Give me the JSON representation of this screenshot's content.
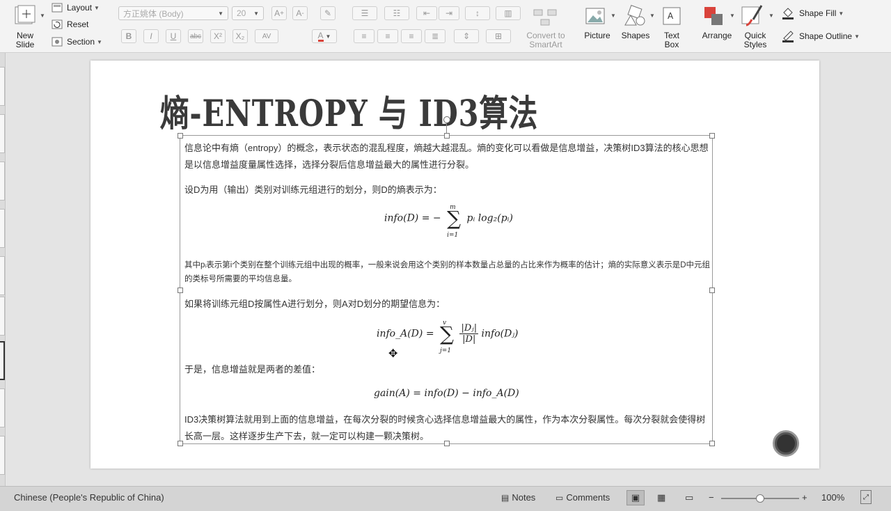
{
  "ribbon": {
    "new_slide": "New\nSlide",
    "layout": "Layout",
    "reset": "Reset",
    "section": "Section",
    "font_name": "方正姚体 (Body)",
    "font_size": "20",
    "convert_smartart": "Convert to\nSmartArt",
    "picture": "Picture",
    "shapes": "Shapes",
    "text_box": "Text\nBox",
    "arrange": "Arrange",
    "quick_styles": "Quick\nStyles",
    "shape_fill": "Shape Fill",
    "shape_outline": "Shape Outline",
    "format_buttons": [
      "B",
      "I",
      "U",
      "abc",
      "X²",
      "X₂",
      "AV",
      "A"
    ],
    "accent": "#d9433b"
  },
  "slide": {
    "title": "熵-ENTROPY 与 ID3算法",
    "p1": "信息论中有熵（entropy）的概念，表示状态的混乱程度，熵越大越混乱。熵的变化可以看做是信息增益，决策树ID3算法的核心思想是以信息增益度量属性选择，选择分裂后信息增益最大的属性进行分裂。",
    "p2": "设D为用（输出）类别对训练元组进行的划分，则D的熵表示为：",
    "f1_left": "info(D) = −",
    "f1_sum_top": "m",
    "f1_sum_bottom": "i=1",
    "f1_right": "pᵢ log₂(pᵢ)",
    "p3": "其中pᵢ表示第i个类别在整个训练元组中出现的概率，一般来说会用这个类别的样本数量占总量的占比来作为概率的估计；熵的实际意义表示是D中元组的类标号所需要的平均信息量。",
    "p4": "如果将训练元组D按属性A进行划分，则A对D划分的期望信息为：",
    "f2_left": "info_A(D) =",
    "f2_sum_top": "v",
    "f2_sum_bottom": "j=1",
    "f2_num": "|Dⱼ|",
    "f2_den": "|D|",
    "f2_right": "info(Dⱼ)",
    "p5": "于是，信息增益就是两者的差值：",
    "f3": "gain(A) = info(D) − info_A(D)",
    "p6": "ID3决策树算法就用到上面的信息增益，在每次分裂的时候贪心选择信息增益最大的属性，作为本次分裂属性。每次分裂就会使得树长高一层。这样逐步生产下去，就一定可以构建一颗决策树。"
  },
  "status": {
    "language": "Chinese (People's Republic of China)",
    "notes": "Notes",
    "comments": "Comments",
    "zoom": "100%",
    "zoom_level_fraction": 0.5
  }
}
